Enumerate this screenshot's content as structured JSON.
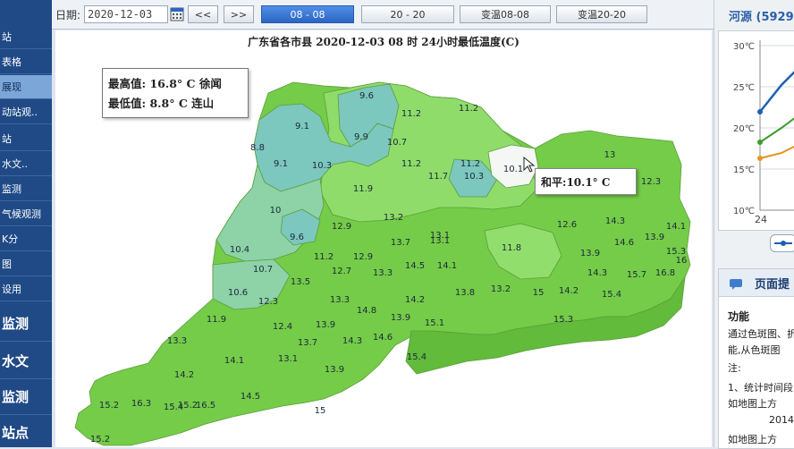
{
  "sidebar": {
    "items": [
      {
        "label": "站"
      },
      {
        "label": "表格"
      },
      {
        "label": "展现"
      },
      {
        "label": "动站观.."
      },
      {
        "label": "站"
      },
      {
        "label": "水文.."
      },
      {
        "label": "监测"
      },
      {
        "label": "气候观测"
      },
      {
        "label": "K分"
      },
      {
        "label": "图"
      },
      {
        "label": "设用"
      },
      {
        "label": "监测"
      },
      {
        "label": "水文"
      },
      {
        "label": "监测"
      },
      {
        "label": "站点"
      }
    ]
  },
  "toolbar": {
    "date_label": "日期:",
    "date_value": "2020-12-03",
    "prev_label": "<<",
    "next_label": ">>",
    "period_buttons": [
      {
        "label": "08 - 08",
        "selected": true
      },
      {
        "label": "20 - 20",
        "selected": false
      },
      {
        "label": "变温08-08",
        "selected": false
      },
      {
        "label": "变温20-20",
        "selected": false
      }
    ]
  },
  "map": {
    "title": "广东省各市县  2020-12-03 08 时  24小时最低温度(C)",
    "max_label": "最高值:",
    "max_value": "16.8° C",
    "max_station": "徐闻",
    "min_label": "最低值:",
    "min_value": "8.8° C",
    "min_station": "连山",
    "tooltip_station": "和平",
    "tooltip_value": "10.1° C",
    "labels": [
      "9.6",
      "11.2",
      "11.2",
      "9.1",
      "9.9",
      "10.7",
      "11.2",
      "11.2",
      "8.8",
      "9.1",
      "10.3",
      "13",
      "10.1",
      "11.7",
      "10.3",
      "12.3",
      "11.9",
      "10",
      "13.2",
      "13.1",
      "12.6",
      "14.3",
      "14.1",
      "12.9",
      "9.6",
      "13.7",
      "13.1",
      "14.6",
      "13.9",
      "10.4",
      "11.2",
      "12.9",
      "11.8",
      "15.3",
      "16",
      "10.7",
      "12.7",
      "13.3",
      "14.5",
      "14.1",
      "13.9",
      "14.3",
      "15.7",
      "16.8",
      "13.5",
      "10.6",
      "12.3",
      "13.3",
      "14.2",
      "13.8",
      "13.2",
      "15",
      "14.2",
      "15.4",
      "14.8",
      "15.3",
      "11.9",
      "12.4",
      "13.9",
      "13.9",
      "15.1",
      "13.3",
      "13.7",
      "14.3",
      "14.6",
      "14.1",
      "13.1",
      "15.4",
      "13.9",
      "14.2",
      "15.2",
      "14.5",
      "16.3",
      "15.2",
      "15.4",
      "16.5",
      "15",
      "15.2"
    ]
  },
  "right_panel": {
    "title": "河源 (5929",
    "y_ticks": [
      "30℃",
      "25℃",
      "20℃",
      "15℃",
      "10℃"
    ],
    "x_tick": "24",
    "notes_header": "页面提",
    "notes": [
      "功能",
      "通过色斑图、折",
      "能,从色斑图",
      "注:",
      "1、统计时间段",
      "如地图上方",
      "2014",
      "如地图上方"
    ]
  },
  "colors": {
    "sidebar_bg": "#1f4a86",
    "selected_button": "#2b65c4",
    "map_teal": "#7cc7be",
    "map_light_green": "#8fdc6a",
    "map_green": "#75cc48",
    "map_dark_green": "#62bb3a"
  }
}
